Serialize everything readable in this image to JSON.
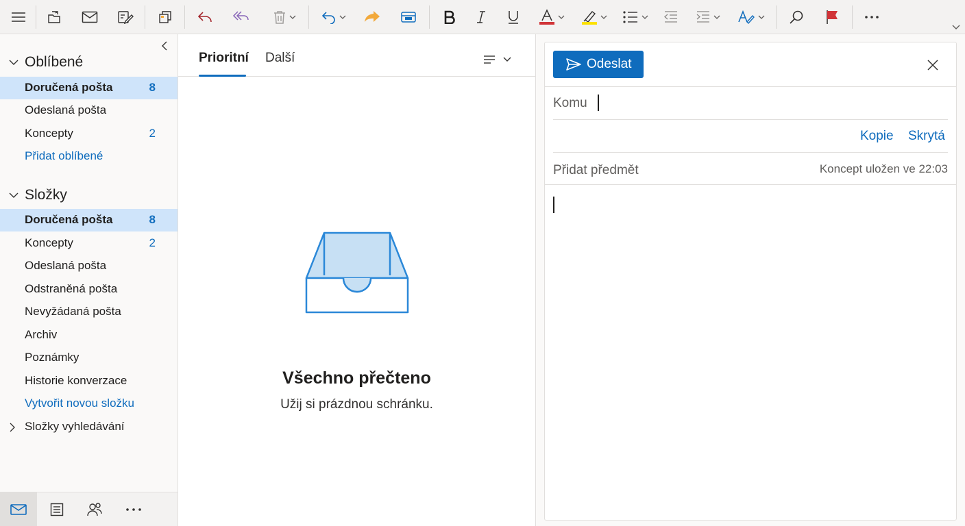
{
  "colors": {
    "accent": "#0f6cbd",
    "selected_bg": "#cfe4fa",
    "flag": "#d13438",
    "font_red": "#d13438",
    "highlight_yellow": "#fce100",
    "forward": "#f2a93b"
  },
  "toolbar": {
    "icons": [
      "hamburger-icon",
      "move-to-icon",
      "envelope-icon",
      "edit-icon",
      "copy-icon",
      "reply-icon",
      "reply-all-icon",
      "delete-icon",
      "undo-icon",
      "forward-icon",
      "insert-icon",
      "bold-icon",
      "italic-icon",
      "underline-icon",
      "font-color-icon",
      "highlight-icon",
      "bullets-icon",
      "decrease-indent-icon",
      "increase-indent-icon",
      "styles-icon",
      "search-icon",
      "flag-icon",
      "more-icon",
      "expand-icon"
    ]
  },
  "nav": {
    "favorites_title": "Oblíbené",
    "favorites": [
      {
        "label": "Doručená pošta",
        "count": "8"
      },
      {
        "label": "Odeslaná pošta",
        "count": ""
      },
      {
        "label": "Koncepty",
        "count": "2"
      }
    ],
    "add_favorite": "Přidat oblíbené",
    "folders_title": "Složky",
    "folders": [
      {
        "label": "Doručená pošta",
        "count": "8"
      },
      {
        "label": "Koncepty",
        "count": "2"
      },
      {
        "label": "Odeslaná pošta",
        "count": ""
      },
      {
        "label": "Odstraněná pošta",
        "count": ""
      },
      {
        "label": "Nevyžádaná pošta",
        "count": ""
      },
      {
        "label": "Archiv",
        "count": ""
      },
      {
        "label": "Poznámky",
        "count": ""
      },
      {
        "label": "Historie konverzace",
        "count": ""
      }
    ],
    "new_folder": "Vytvořit novou složku",
    "search_folders": "Složky vyhledávání"
  },
  "list": {
    "tabs": [
      "Prioritní",
      "Další"
    ],
    "active_tab": "Prioritní",
    "empty_title": "Všechno přečteno",
    "empty_subtitle": "Užij si prázdnou schránku."
  },
  "compose": {
    "send_label": "Odeslat",
    "to_label": "Komu",
    "to_value": "",
    "cc_label": "Kopie",
    "bcc_label": "Skrytá",
    "subject_placeholder": "Přidat předmět",
    "draft_status": "Koncept uložen ve 22:03",
    "body": ""
  },
  "appbar": {
    "icons": [
      "mail-icon",
      "calendar-icon",
      "people-icon",
      "more-apps-icon"
    ],
    "active": "mail-icon"
  }
}
